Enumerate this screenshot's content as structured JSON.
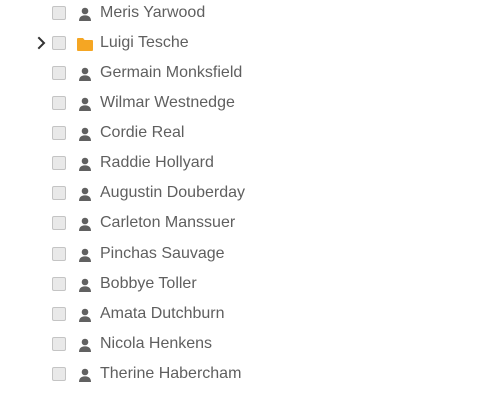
{
  "tree": {
    "items": [
      {
        "label": "Meris Yarwood",
        "type": "person",
        "icon": "person-icon"
      },
      {
        "label": "Luigi Tesche",
        "type": "folder",
        "icon": "folder-icon",
        "collapsed": true,
        "folder_color": "#f5a623"
      },
      {
        "label": "Germain Monksfield",
        "type": "person",
        "icon": "person-icon"
      },
      {
        "label": "Wilmar Westnedge",
        "type": "person",
        "icon": "person-icon"
      },
      {
        "label": "Cordie Real",
        "type": "person",
        "icon": "person-icon"
      },
      {
        "label": "Raddie Hollyard",
        "type": "person",
        "icon": "person-icon"
      },
      {
        "label": "Augustin Douberday",
        "type": "person",
        "icon": "person-icon"
      },
      {
        "label": "Carleton Manssuer",
        "type": "person",
        "icon": "person-icon"
      },
      {
        "label": "Pinchas Sauvage",
        "type": "person",
        "icon": "person-icon"
      },
      {
        "label": "Bobbye Toller",
        "type": "person",
        "icon": "person-icon"
      },
      {
        "label": "Amata Dutchburn",
        "type": "person",
        "icon": "person-icon"
      },
      {
        "label": "Nicola Henkens",
        "type": "person",
        "icon": "person-icon"
      },
      {
        "label": "Therine Habercham",
        "type": "person",
        "icon": "person-icon"
      }
    ]
  }
}
